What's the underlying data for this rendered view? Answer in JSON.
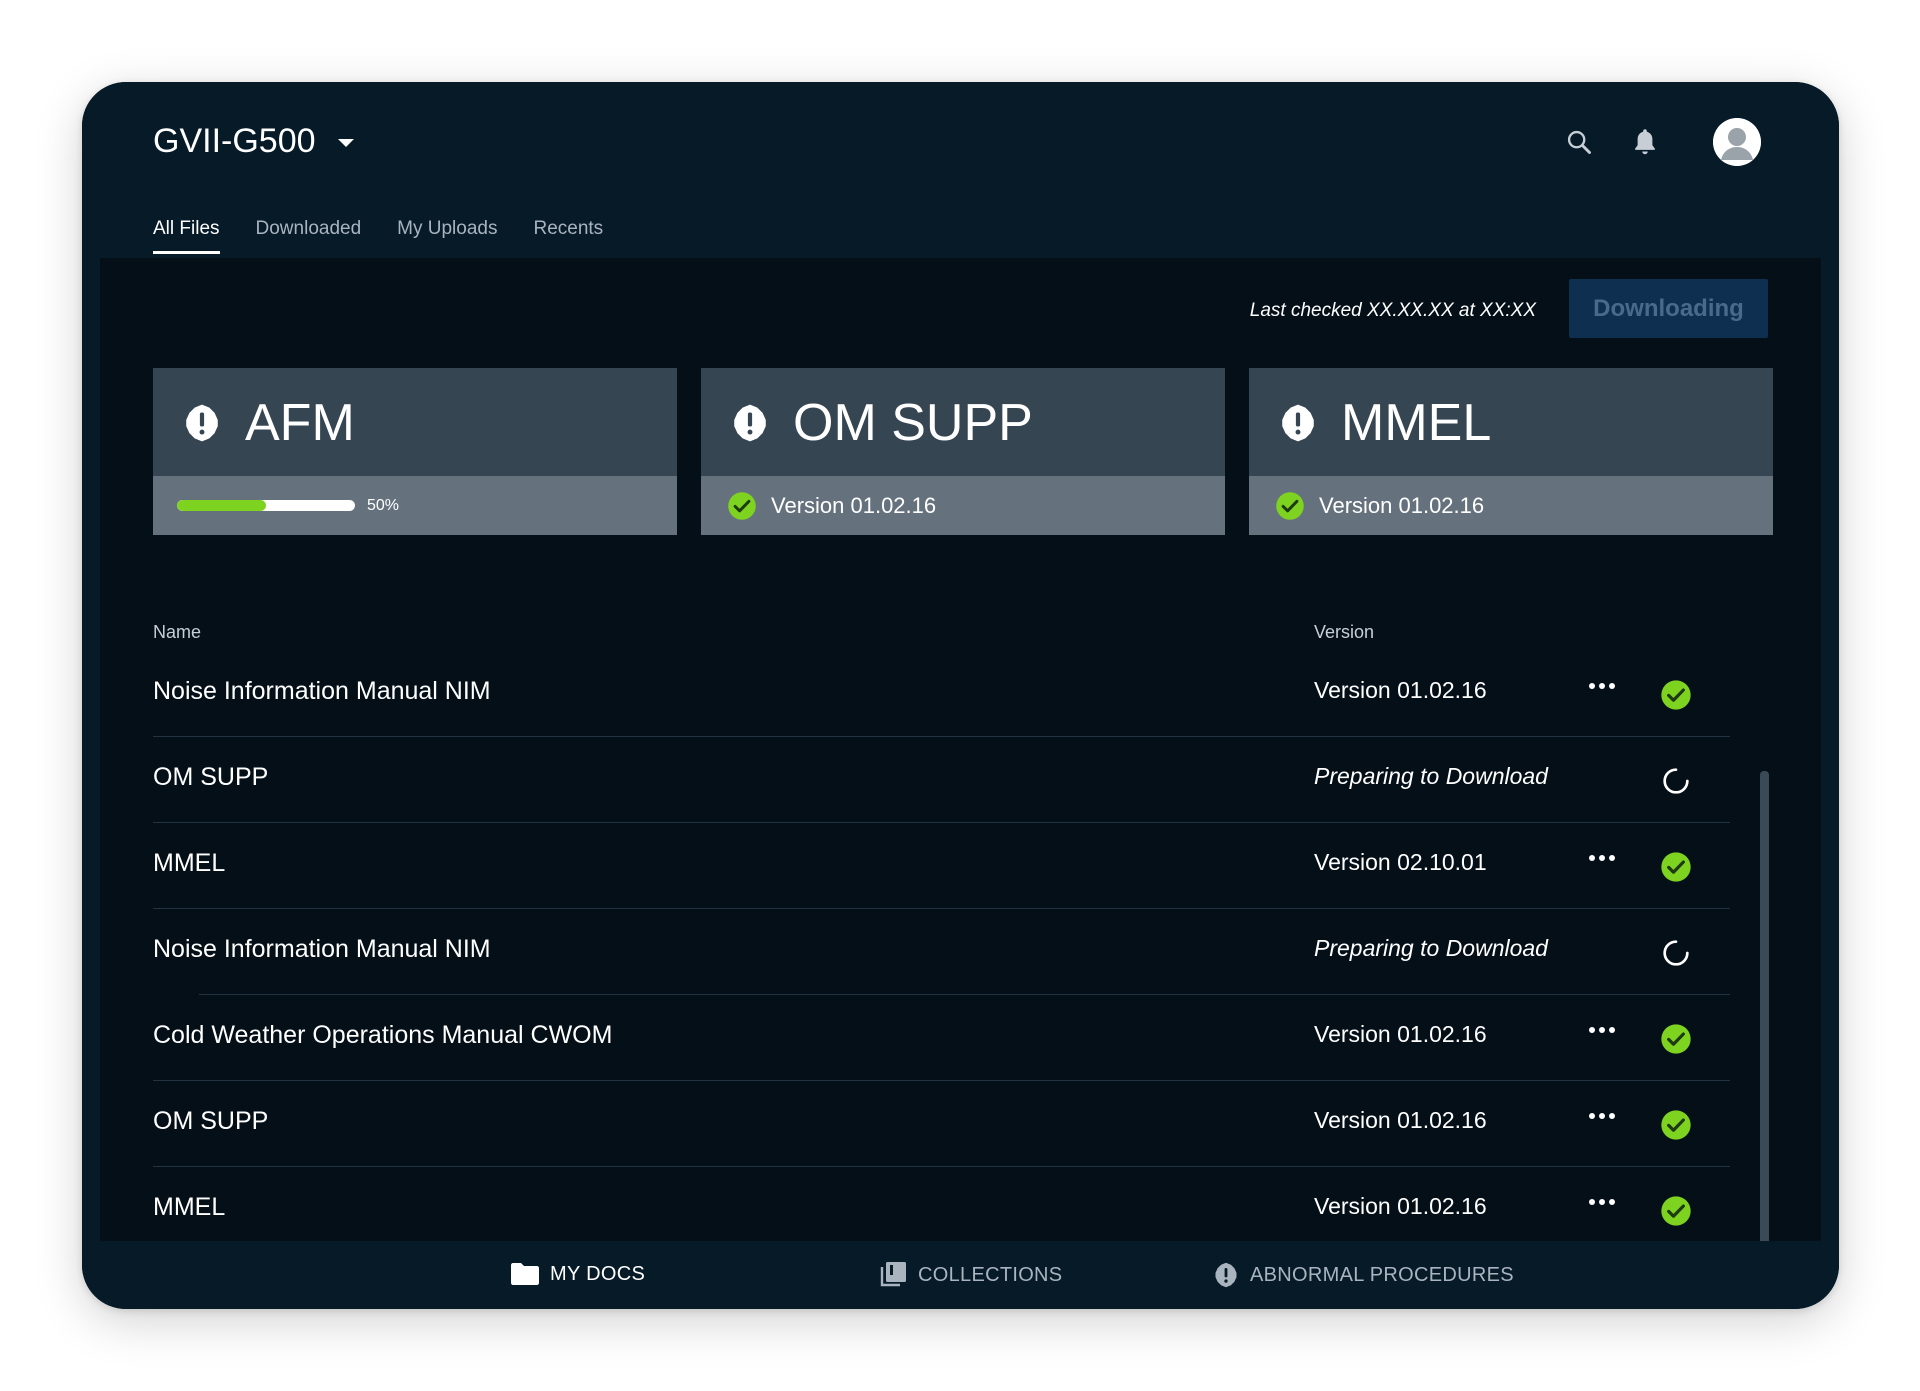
{
  "header": {
    "tail": "GVII-G500",
    "icons": [
      "search-icon",
      "bell-icon",
      "avatar"
    ]
  },
  "tabs": [
    {
      "label": "All Files",
      "active": true
    },
    {
      "label": "Downloaded",
      "active": false
    },
    {
      "label": "My Uploads",
      "active": false
    },
    {
      "label": "Recents",
      "active": false
    }
  ],
  "toolbar": {
    "last_checked": "Last checked XX.XX.XX at XX:XX",
    "download_button": "Downloading"
  },
  "cards": [
    {
      "title": "AFM",
      "progress": 0.5,
      "progress_label": "50%"
    },
    {
      "title": "OM SUPP",
      "version": "Version 01.02.16"
    },
    {
      "title": "MMEL",
      "version": "Version 01.02.16"
    }
  ],
  "table": {
    "headers": {
      "name": "Name",
      "version": "Version"
    },
    "rows": [
      {
        "name": "Noise Information Manual NIM",
        "version": "Version 01.02.16",
        "status": "done"
      },
      {
        "name": "OM SUPP",
        "version": "Preparing to Download",
        "status": "loading"
      },
      {
        "name": "MMEL",
        "version": "Version 02.10.01",
        "status": "done"
      },
      {
        "name": "Noise Information Manual NIM",
        "version": "Preparing to Download",
        "status": "loading"
      },
      {
        "name": "Cold Weather Operations Manual CWOM",
        "version": "Version 01.02.16",
        "status": "done"
      },
      {
        "name": "OM SUPP",
        "version": "Version 01.02.16",
        "status": "done"
      },
      {
        "name": "MMEL",
        "version": "Version 01.02.16",
        "status": "done"
      }
    ]
  },
  "bottom_nav": [
    {
      "label": "MY DOCS",
      "icon": "folder-icon",
      "active": true
    },
    {
      "label": "COLLECTIONS",
      "icon": "collections-icon",
      "active": false
    },
    {
      "label": "ABNORMAL PROCEDURES",
      "icon": "alert-icon",
      "active": false
    }
  ],
  "colors": {
    "background": "#061a28",
    "content": "#040f18",
    "card": "#364552",
    "card_footer": "#65727e",
    "accent_green": "#7ed321",
    "button_bg": "#0e2f4f"
  }
}
